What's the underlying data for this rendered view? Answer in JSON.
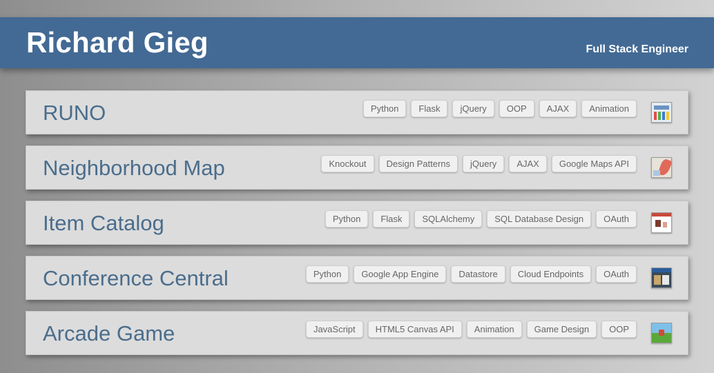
{
  "header": {
    "name": "Richard Gieg",
    "role": "Full Stack Engineer"
  },
  "colors": {
    "header_bg": "#436a94",
    "title_text": "#4a6d8c",
    "card_bg": "#dcdcdc"
  },
  "projects": [
    {
      "title": "RUNO",
      "tags": [
        "Python",
        "Flask",
        "jQuery",
        "OOP",
        "AJAX",
        "Animation"
      ],
      "thumbnail_icon": "runo-thumbnail-icon"
    },
    {
      "title": "Neighborhood Map",
      "tags": [
        "Knockout",
        "Design Patterns",
        "jQuery",
        "AJAX",
        "Google Maps API"
      ],
      "thumbnail_icon": "map-thumbnail-icon"
    },
    {
      "title": "Item Catalog",
      "tags": [
        "Python",
        "Flask",
        "SQLAlchemy",
        "SQL Database Design",
        "OAuth"
      ],
      "thumbnail_icon": "catalog-thumbnail-icon"
    },
    {
      "title": "Conference Central",
      "tags": [
        "Python",
        "Google App Engine",
        "Datastore",
        "Cloud Endpoints",
        "OAuth"
      ],
      "thumbnail_icon": "conference-thumbnail-icon"
    },
    {
      "title": "Arcade Game",
      "tags": [
        "JavaScript",
        "HTML5 Canvas API",
        "Animation",
        "Game Design",
        "OOP"
      ],
      "thumbnail_icon": "arcade-thumbnail-icon"
    }
  ]
}
